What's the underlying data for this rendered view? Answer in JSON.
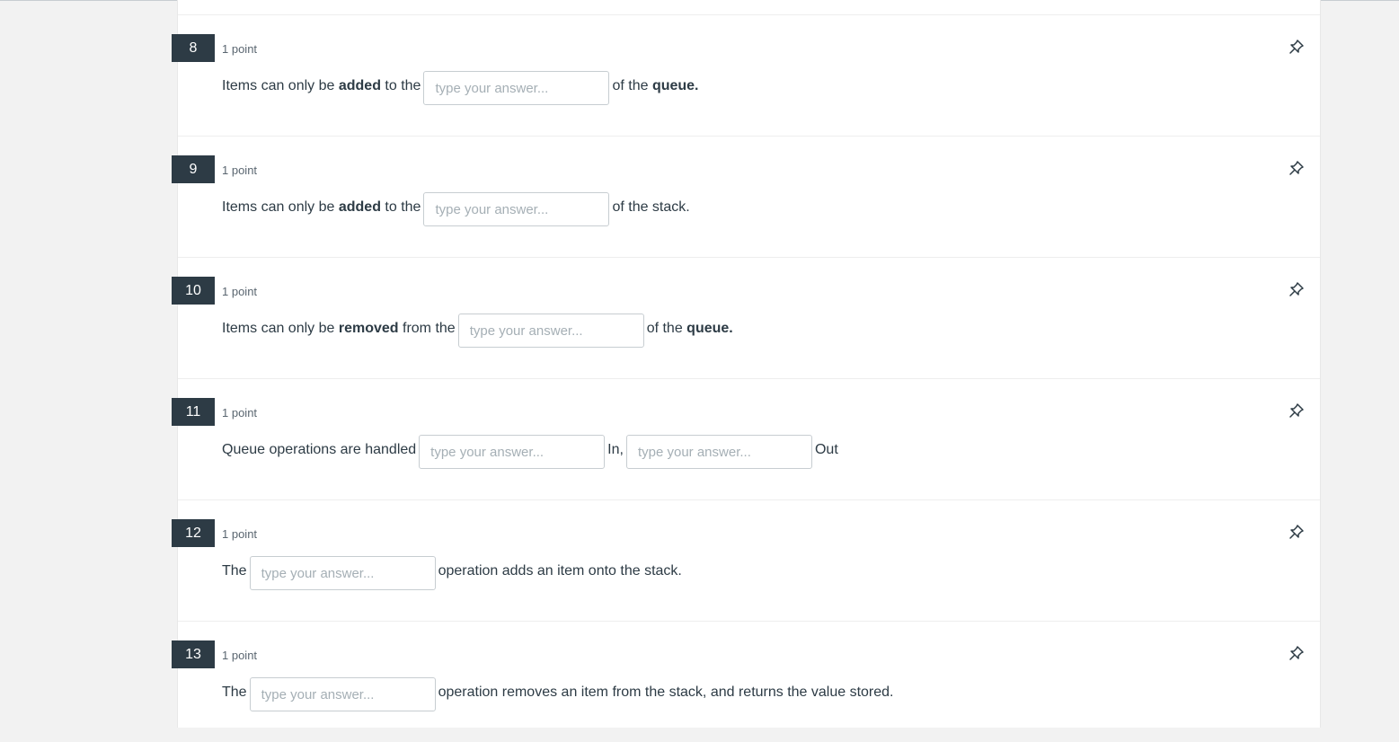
{
  "questions": [
    {
      "number": "8",
      "points": "1 point",
      "segments": [
        "Items can only be ",
        "added",
        " to the",
        "of the ",
        "queue."
      ],
      "placeholder": "type your answer..."
    },
    {
      "number": "9",
      "points": "1 point",
      "segments": [
        "Items can only be ",
        "added",
        " to the",
        "of the stack."
      ],
      "placeholder": "type your answer..."
    },
    {
      "number": "10",
      "points": "1 point",
      "segments": [
        "Items can only be ",
        "removed",
        " from the",
        "of the ",
        "queue."
      ],
      "placeholder": "type your answer..."
    },
    {
      "number": "11",
      "points": "1 point",
      "segments": [
        "Queue operations are handled",
        "In,",
        "Out"
      ],
      "placeholder": "type your answer...",
      "placeholder2": "type your answer..."
    },
    {
      "number": "12",
      "points": "1 point",
      "segments": [
        "The",
        "operation adds an item onto the stack."
      ],
      "placeholder": "type your answer..."
    },
    {
      "number": "13",
      "points": "1 point",
      "segments": [
        "The",
        "operation removes an item from the stack, and returns the value stored."
      ],
      "placeholder": "type your answer..."
    }
  ],
  "icons": {
    "pin": "pushpin-icon"
  },
  "colors": {
    "badge": "#2d3b45",
    "text": "#2d3b45",
    "border": "#c7cdd1"
  }
}
